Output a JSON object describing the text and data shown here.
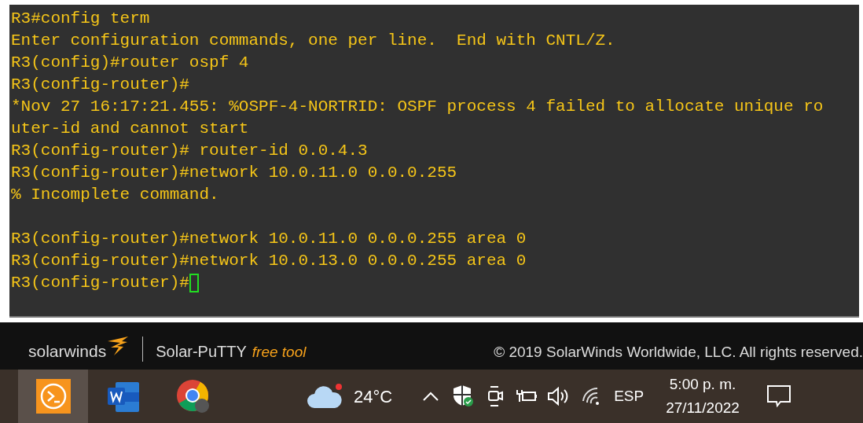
{
  "terminal": {
    "blocks": [
      {
        "lines": [
          {
            "text": "R3#config term"
          },
          {
            "text": "Enter configuration commands, one per line.  End with CNTL/Z."
          },
          {
            "text": "R3(config)#router ospf 4"
          },
          {
            "text": "R3(config-router)#"
          },
          {
            "text": "*Nov 27 16:17:21.455: %OSPF-4-NORTRID: OSPF process 4 failed to allocate unique ro"
          },
          {
            "text": "uter-id and cannot start"
          },
          {
            "text": "R3(config-router)# router-id 0.0.4.3"
          },
          {
            "text": "R3(config-router)#network 10.0.11.0 0.0.0.255"
          },
          {
            "text": "% Incomplete command."
          }
        ]
      },
      {
        "lines": [
          {
            "text": "R3(config-router)#network 10.0.11.0 0.0.0.255 area 0"
          },
          {
            "text": "R3(config-router)#network 10.0.13.0 0.0.0.255 area 0"
          },
          {
            "text": "R3(config-router)#",
            "cursor": true
          }
        ]
      }
    ]
  },
  "banner": {
    "brand": "solarwinds",
    "product": "Solar-PuTTY",
    "tag": "free tool",
    "copyright": "© 2019 SolarWinds Worldwide, LLC. All rights reserved."
  },
  "taskbar": {
    "apps": [
      {
        "kind": "terminal",
        "selected": true
      },
      {
        "kind": "word",
        "selected": false
      },
      {
        "kind": "chrome",
        "selected": false
      }
    ],
    "weather": {
      "temp": "24°C"
    },
    "language": "ESP",
    "time": "5:00 p. m.",
    "date": "27/11/2022"
  }
}
